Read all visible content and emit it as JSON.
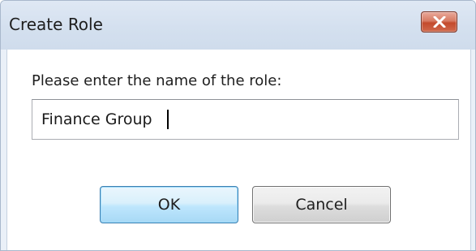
{
  "window": {
    "title": "Create Role",
    "close_icon": "close-icon"
  },
  "dialog": {
    "prompt": "Please enter the name of the role:",
    "name_value": "Finance Group",
    "ok_label": "OK",
    "cancel_label": "Cancel"
  },
  "colors": {
    "titlebar": "#d4e0ef",
    "close_button": "#c34a2c",
    "default_button_border": "#3c7fb1"
  }
}
